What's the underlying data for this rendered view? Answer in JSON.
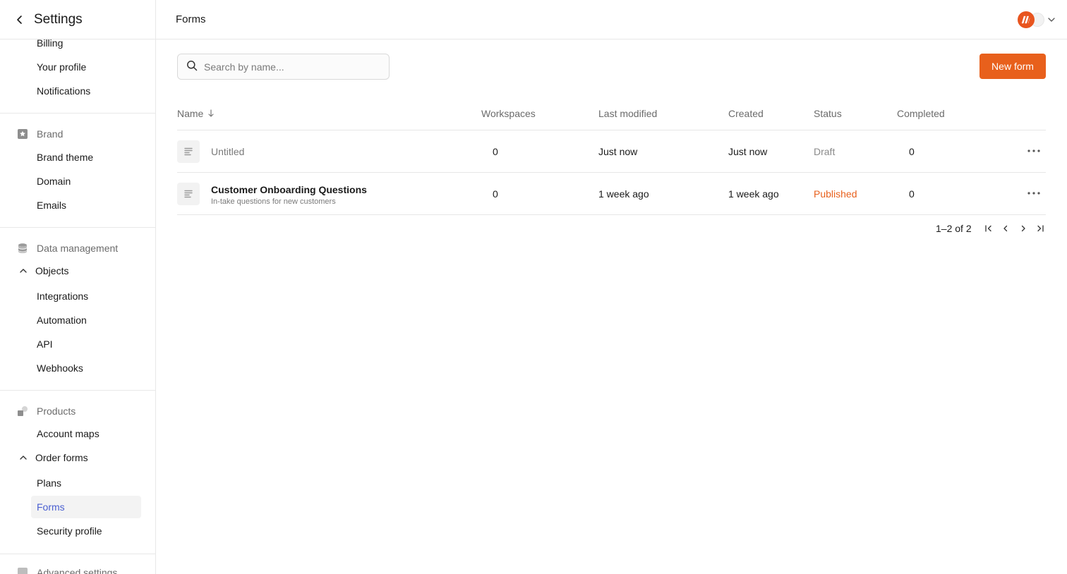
{
  "sidebar": {
    "title": "Settings",
    "account_items": [
      "Billing",
      "Your profile",
      "Notifications"
    ],
    "brand": {
      "label": "Brand",
      "items": [
        "Brand theme",
        "Domain",
        "Emails"
      ]
    },
    "data_management": {
      "label": "Data management",
      "objects_label": "Objects",
      "items": [
        "Integrations",
        "Automation",
        "API",
        "Webhooks"
      ]
    },
    "products": {
      "label": "Products",
      "account_maps": "Account maps",
      "order_forms_label": "Order forms",
      "items": [
        "Plans",
        "Forms",
        "Security profile"
      ],
      "active_item": "Forms"
    },
    "advanced": {
      "label": "Advanced settings"
    }
  },
  "header": {
    "title": "Forms"
  },
  "search": {
    "placeholder": "Search by name..."
  },
  "toolbar": {
    "new_form_label": "New form"
  },
  "table": {
    "columns": [
      "Name",
      "Workspaces",
      "Last modified",
      "Created",
      "Status",
      "Completed"
    ],
    "rows": [
      {
        "name": "Untitled",
        "description": "",
        "workspaces": "0",
        "last_modified": "Just now",
        "created": "Just now",
        "status": "Draft",
        "completed": "0"
      },
      {
        "name": "Customer Onboarding Questions",
        "description": "In-take questions for new customers",
        "workspaces": "0",
        "last_modified": "1 week ago",
        "created": "1 week ago",
        "status": "Published",
        "completed": "0"
      }
    ]
  },
  "pagination": {
    "summary": "1–2 of 2"
  },
  "colors": {
    "accent": "#e8601c",
    "active_link": "#4a5fd1",
    "published": "#e8601c",
    "draft": "#8a8a8a"
  }
}
